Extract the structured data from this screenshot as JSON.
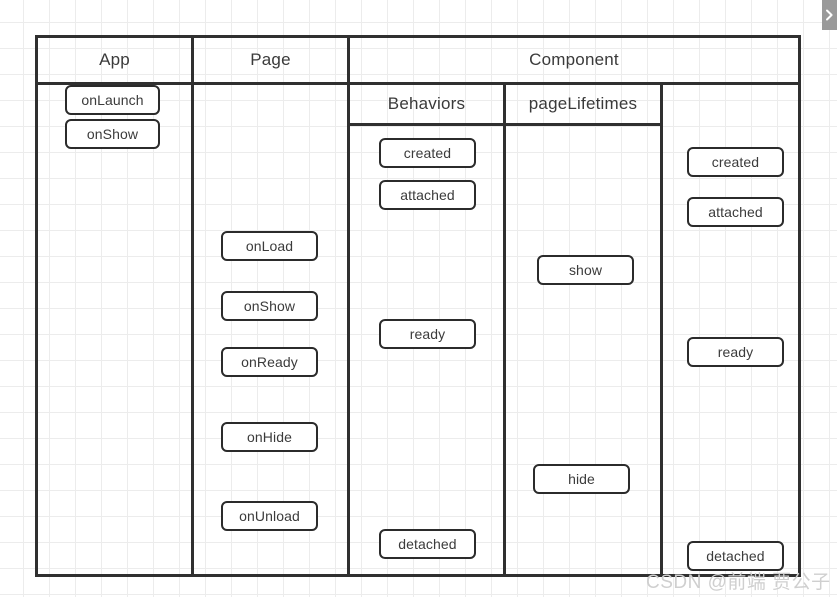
{
  "diagram": {
    "title_columns": [
      {
        "label": "App"
      },
      {
        "label": "Page"
      },
      {
        "label": "Component"
      }
    ],
    "sub_columns": [
      {
        "label": "Behaviors"
      },
      {
        "label": "pageLifetimes"
      }
    ],
    "columns": {
      "app": {
        "header": "App",
        "nodes": [
          {
            "label": "onLaunch"
          },
          {
            "label": "onShow"
          }
        ]
      },
      "page": {
        "header": "Page",
        "nodes": [
          {
            "label": "onLoad"
          },
          {
            "label": "onShow"
          },
          {
            "label": "onReady"
          },
          {
            "label": "onHide"
          },
          {
            "label": "onUnload"
          }
        ]
      },
      "component": {
        "header": "Component",
        "behaviors": {
          "header": "Behaviors",
          "nodes": [
            {
              "label": "created"
            },
            {
              "label": "attached"
            },
            {
              "label": "ready"
            },
            {
              "label": "detached"
            }
          ]
        },
        "page_lifetimes": {
          "header": "pageLifetimes",
          "nodes": [
            {
              "label": "show"
            },
            {
              "label": "hide"
            }
          ]
        },
        "lifetimes": {
          "header": "",
          "nodes": [
            {
              "label": "created"
            },
            {
              "label": "attached"
            },
            {
              "label": "ready"
            },
            {
              "label": "detached"
            }
          ]
        }
      }
    }
  },
  "watermark": {
    "text": "CSDN @前端 贾公子"
  },
  "panel_tab": {
    "icon": "chevron-right-icon"
  },
  "colors": {
    "border": "#303030",
    "node_border": "#2b2b2b",
    "grid": "#ececec",
    "text": "#3b3b3b",
    "watermark": "#cfcfcf",
    "panel_tab": "#9a9a9a"
  }
}
